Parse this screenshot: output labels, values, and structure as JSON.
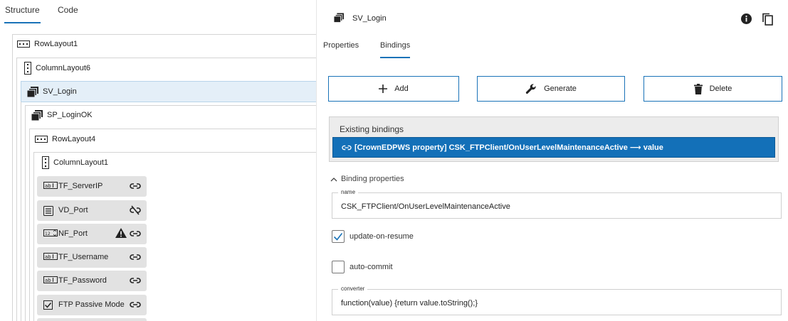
{
  "left_panel": {
    "tabs": [
      {
        "label": "Structure",
        "active": true
      },
      {
        "label": "Code",
        "active": false
      }
    ],
    "tree": {
      "row_layout_1": "RowLayout1",
      "column_layout_6": "ColumnLayout6",
      "sv_login": "SV_Login",
      "sp_login_ok": "SP_LoginOK",
      "row_layout_4": "RowLayout4",
      "column_layout_1": "ColumnLayout1",
      "leaves": [
        {
          "label": "TF_ServerIP",
          "icon": "text-field-icon",
          "link": "link-icon"
        },
        {
          "label": "VD_Port",
          "icon": "value-display-icon",
          "link": "unlink-icon"
        },
        {
          "label": "NF_Port",
          "icon": "numeric-field-icon",
          "link": "link-icon",
          "warning": true
        },
        {
          "label": "TF_Username",
          "icon": "text-field-icon",
          "link": "link-icon"
        },
        {
          "label": "TF_Password",
          "icon": "text-field-icon",
          "link": "link-icon"
        },
        {
          "label": "FTP Passive Mode",
          "icon": "checkbox-icon",
          "link": "link-icon"
        }
      ]
    }
  },
  "right_panel": {
    "header_title": "SV_Login",
    "tabs": [
      {
        "label": "Properties",
        "active": false
      },
      {
        "label": "Bindings",
        "active": true
      }
    ],
    "buttons": {
      "add": "Add",
      "generate": "Generate",
      "delete": "Delete"
    },
    "existing_bindings": {
      "label": "Existing bindings",
      "items": [
        "[CrownEDPWS property] CSK_FTPClient/OnUserLevelMaintenanceActive ⟶ value"
      ]
    },
    "binding_properties": {
      "label": "Binding properties",
      "name_label": "name",
      "name_value": "CSK_FTPClient/OnUserLevelMaintenanceActive",
      "update_on_resume_label": "update-on-resume",
      "update_on_resume_checked": true,
      "auto_commit_label": "auto-commit",
      "auto_commit_checked": false,
      "converter_label": "converter",
      "converter_value": "function(value) {return value.toString();}"
    }
  },
  "colors": {
    "accent": "#1a73b8",
    "selected_binding": "#1370b8",
    "selected_tree_row": "#e4eff8"
  }
}
